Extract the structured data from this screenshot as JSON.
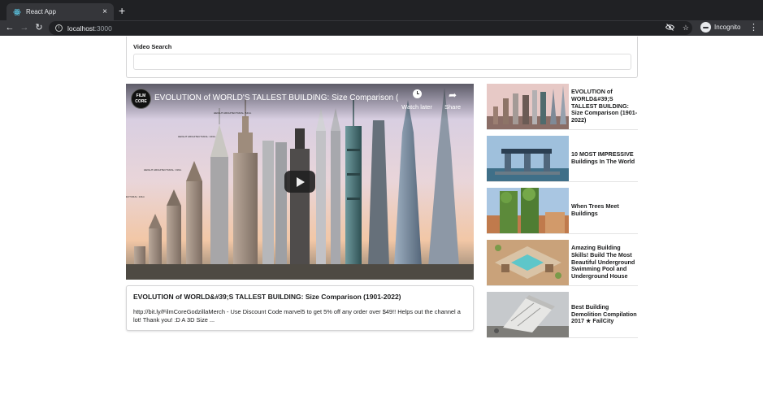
{
  "browser": {
    "tab_title": "React App",
    "tab_close": "×",
    "new_tab": "+",
    "url_host": "localhost",
    "url_port": ":3000",
    "incognito_label": "Incognito"
  },
  "search": {
    "label": "Video Search",
    "value": "",
    "placeholder": ""
  },
  "player": {
    "channel_avatar_text": "FILM CORE",
    "video_title": "EVOLUTION of WORLD'S TALLEST BUILDING: Size Comparison (…",
    "watch_later_label": "Watch later",
    "share_label": "Share"
  },
  "selected_video": {
    "title": "EVOLUTION of WORLD&#39;S TALLEST BUILDING: Size Comparison (1901-2022)",
    "description": "http://bit.ly/FilmCoreGodzillaMerch - Use Discount Code marvel5 to get 5% off any order over $49!! Helps out the channel a lot! Thank you! :D A 3D Size ..."
  },
  "video_list": [
    {
      "title": "EVOLUTION of WORLD&#39;S TALLEST BUILDING: Size Comparison (1901-2022)"
    },
    {
      "title": "10 MOST IMPRESSIVE Buildings In The World"
    },
    {
      "title": "When Trees Meet Buildings"
    },
    {
      "title": "Amazing Building Skills! Build The Most Beautiful Underground Swimming Pool and Underground House"
    },
    {
      "title": "Best Building Demolition Compilation 2017 ★ FailCity"
    }
  ],
  "colors": {
    "chrome_dark": "#202124",
    "chrome_toolbar": "#35363a",
    "text_primary": "#1b1c1d",
    "border": "#d4d4d5"
  }
}
